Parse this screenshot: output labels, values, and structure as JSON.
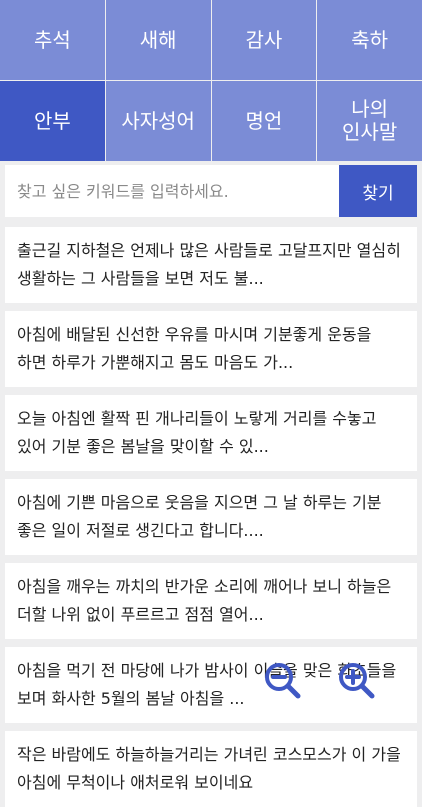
{
  "categories": [
    {
      "label": "추석"
    },
    {
      "label": "새해"
    },
    {
      "label": "감사"
    },
    {
      "label": "축하"
    },
    {
      "label": "안부"
    },
    {
      "label": "사자성어"
    },
    {
      "label": "명언"
    },
    {
      "label": "나의\n인사말"
    }
  ],
  "active_category": "안부",
  "search": {
    "placeholder": "찾고 싶은 키워드를 입력하세요.",
    "button_label": "찾기"
  },
  "messages": [
    {
      "text": "출근길 지하철은 언제나 많은 사람들로 고달프지만 열심히 생활하는 그 사람들을 보면 저도 불..."
    },
    {
      "text": "아침에 배달된 신선한 우유를 마시며 기분좋게 운동을 하면 하루가 가뿐해지고 몸도 마음도 가..."
    },
    {
      "text": "오늘 아침엔 활짝 핀 개나리들이 노랗게 거리를 수놓고 있어 기분 좋은 봄날을 맞이할 수 있..."
    },
    {
      "text": "아침에 기쁜 마음으로 웃음을 지으면 그 날 하루는 기분 좋은 일이 저절로 생긴다고 합니다...."
    },
    {
      "text": "아침을 깨우는 까치의 반가운 소리에 깨어나 보니 하늘은 더할 나위 없이 푸르르고 점점 열어..."
    },
    {
      "text": "아침을 먹기 전 마당에 나가 밤사이 이슬을 맞은 화초들을 보며 화사한 5월의 봄날 아침을 ..."
    },
    {
      "text": "작은 바람에도 하늘하늘거리는 가녀린 코스모스가 이 가을 아침에 무척이나 애처로워 보이네요"
    }
  ],
  "colors": {
    "category_bg": "#7b8cd6",
    "category_active_bg": "#3f58c4",
    "zoom_icon": "#3f58c4"
  },
  "icons": {
    "zoom_out": "zoom-out-icon",
    "zoom_in": "zoom-in-icon"
  }
}
